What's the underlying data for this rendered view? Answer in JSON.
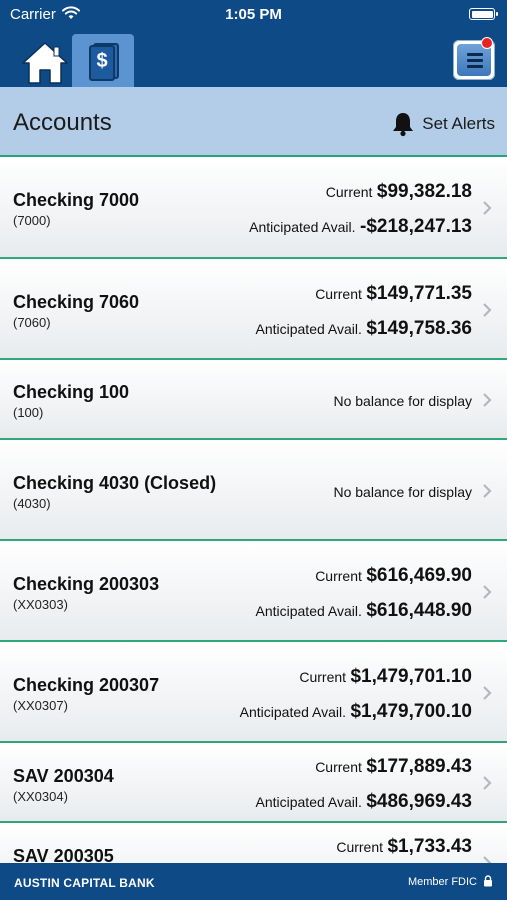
{
  "status": {
    "carrier": "Carrier",
    "time": "1:05 PM"
  },
  "header": {
    "title": "Accounts",
    "set_alerts": "Set Alerts"
  },
  "accounts": [
    {
      "name": "Checking 7000",
      "number": "(7000)",
      "current_label": "Current",
      "current": "$99,382.18",
      "anticipated_label": "Anticipated Avail.",
      "anticipated": "-$218,247.13"
    },
    {
      "name": "Checking 7060",
      "number": "(7060)",
      "current_label": "Current",
      "current": "$149,771.35",
      "anticipated_label": "Anticipated Avail.",
      "anticipated": "$149,758.36"
    },
    {
      "name": "Checking 100",
      "number": "(100)",
      "no_balance": "No balance for display"
    },
    {
      "name": "Checking 4030 (Closed)",
      "number": "(4030)",
      "no_balance": "No balance for display"
    },
    {
      "name": "Checking 200303",
      "number": "(XX0303)",
      "current_label": "Current",
      "current": "$616,469.90",
      "anticipated_label": "Anticipated Avail.",
      "anticipated": "$616,448.90"
    },
    {
      "name": "Checking 200307",
      "number": "(XX0307)",
      "current_label": "Current",
      "current": "$1,479,701.10",
      "anticipated_label": "Anticipated Avail.",
      "anticipated": "$1,479,700.10"
    },
    {
      "name": "SAV 200304",
      "number": "(XX0304)",
      "current_label": "Current",
      "current": "$177,889.43",
      "anticipated_label": "Anticipated Avail.",
      "anticipated": "$486,969.43"
    },
    {
      "name": "SAV 200305",
      "number": "",
      "current_label": "Current",
      "current": "$1,733.43"
    }
  ],
  "footer": {
    "bank": "AUSTIN CAPITAL BANK",
    "fdic": "Member FDIC"
  },
  "colors": {
    "nav": "#0e4a86",
    "subheader": "#b3cde8",
    "divider": "#2fa77b",
    "active_tab": "#5c93d1",
    "notification": "#e52525"
  },
  "icons": [
    "wifi-icon",
    "battery-icon",
    "home-icon",
    "accounts-icon",
    "menu-icon",
    "bell-icon",
    "chevron-right-icon",
    "lock-icon"
  ]
}
